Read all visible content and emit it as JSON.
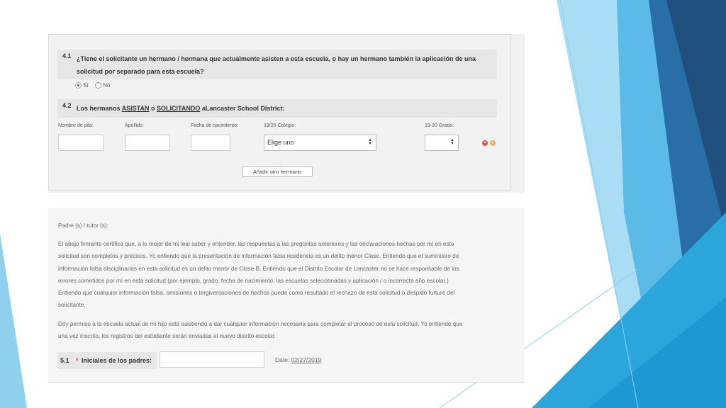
{
  "theme": {
    "accent_dark": "#2a5f8f",
    "accent_mid": "#3aa3d8",
    "accent_light": "#8fd0ef",
    "remove_color": "#d9534f",
    "add_color": "#f0ad4e"
  },
  "q41": {
    "number": "4.1",
    "text_line1": "¿Tiene el solicitante un hermano / hermana que actualmente asisten a esta escuela, o hay un hermano también la aplicación de una",
    "text_line2": "solicitud por separado para esta escuela?",
    "options": [
      {
        "label": "Sí",
        "selected": true
      },
      {
        "label": "No",
        "selected": false
      }
    ]
  },
  "q42": {
    "number": "4.2",
    "prefix": "Los hermanos ",
    "asistan": "ASISTAN",
    "o": " o ",
    "solicitando": "SOLICITANDO",
    "suffix": " aLancaster School District:"
  },
  "sibling_form": {
    "first_name_label": "Nombre de pila:",
    "last_name_label": "Apellido:",
    "dob_label": "Fecha de nacimiento:",
    "school_label": "19/20 Colegio:",
    "school_value": "Elige uno",
    "grade_label": "19-20 Grado:",
    "grade_value": "",
    "remove_icon": "remove-icon",
    "add_icon": "add-icon",
    "add_sibling_button": "Añadir otro hermano"
  },
  "guardian": {
    "label": "Padre (s) / tutor (s):",
    "paragraph1": [
      "El abajo firmante certifica que, a lo mejor de mi leal saber y entender, las respuestas a las preguntas anteriores y las declaraciones hechas por mí en esta",
      "solicitud son completos y precisos. Yo entiendo que la presentación de información falsa residencia es un delito menor Clase. Entiendo que el suministro de",
      "información falsa disciplinarias en esta solicitud es un delito menor de Clase B. Entiendo que el Distrito Escolar de Lancaster no se hace responsable de los",
      "errores cometidos por mí en esta solicitud (por ejemplo, grado, fecha de nacimiento, las escuelas seleccionadas y aplicación / o incorrecta año escolar.)",
      "Entiendo que cualquier información falsa, omisiones o tergiversaciones de hechos puede como resultado el rechazo de esta solicitud o despido furture del",
      "solicitante."
    ],
    "paragraph2": [
      "Doy permiso a la escuela actual de mi hijo está asistiendo a dar cualquier información necesaria para completar el proceso de esta solicitud. Yo entiendo que",
      "una vez inscrito, los registros del estudiante serán enviadas al nuevo distrito escolar."
    ]
  },
  "q51": {
    "number": "5.1",
    "required_mark": "*",
    "label": "Iniciales de los padres:",
    "value": "",
    "date_label": "Date:",
    "date_value": "02/27/2019"
  }
}
